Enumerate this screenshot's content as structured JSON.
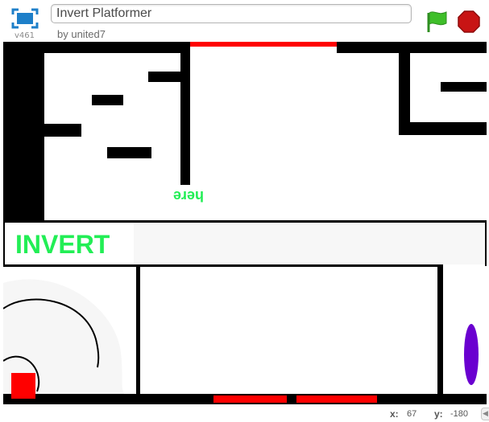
{
  "player": {
    "version": "v461",
    "project_title": "Invert Platformer",
    "byline": "by united7"
  },
  "icons": {
    "fullscreen": "fullscreen-icon",
    "green_flag": "green-flag-icon",
    "stop": "stop-sign-icon"
  },
  "stage": {
    "invert_label": "INVERT",
    "hint_text": "here"
  },
  "colors": {
    "wall": "#000000",
    "hazard": "#ff0000",
    "accent_text": "#22ee55",
    "player": "#ff0000",
    "portal": "#6a00d0",
    "flag": "#3fbf2a",
    "stop": "#c81414"
  },
  "footer": {
    "x_label": "x:",
    "x_value": "67",
    "y_label": "y:",
    "y_value": "-180"
  }
}
